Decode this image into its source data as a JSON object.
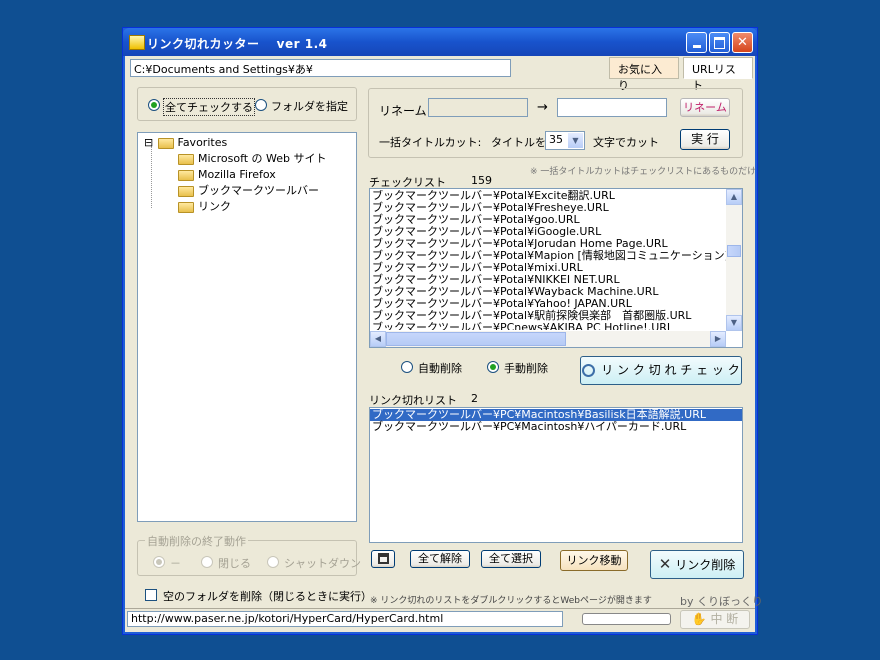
{
  "window": {
    "title": "リンク切れカッター　 ver 1.4"
  },
  "toolbar": {
    "path_value": "C:¥Documents and Settings¥あ¥",
    "tab_favorites": "お気に入り",
    "tab_url_list": "URLリスト"
  },
  "scope": {
    "all_check": "全てチェックする",
    "folder_select": "フォルダを指定",
    "selected": "all_check"
  },
  "tree": {
    "root_toggle": "⊟",
    "root": "Favorites",
    "children": [
      "Microsoft の Web サイト",
      "Mozilla Firefox",
      "ブックマークツールバー",
      "リンク"
    ]
  },
  "rename": {
    "label": "リネーム:",
    "arrow": "→",
    "from_value": "",
    "to_value": "",
    "button": "リネーム"
  },
  "title_cut": {
    "label": "一括タイトルカット:",
    "prefix": "タイトルを",
    "value": "35",
    "suffix": "文字でカット",
    "button": "実 行",
    "note": "※ 一括タイトルカットはチェックリストにあるものだけ"
  },
  "check_list": {
    "label": "チェックリスト",
    "count": "159",
    "items": [
      "ブックマークツールバー¥Potal¥Excite翻訳.URL",
      "ブックマークツールバー¥Potal¥Fresheye.URL",
      "ブックマークツールバー¥Potal¥goo.URL",
      "ブックマークツールバー¥Potal¥iGoogle.URL",
      "ブックマークツールバー¥Potal¥Jorudan Home Page.URL",
      "ブックマークツールバー¥Potal¥Mapion [情報地図コミュニケーション].URL",
      "ブックマークツールバー¥Potal¥mixi.URL",
      "ブックマークツールバー¥Potal¥NIKKEI NET.URL",
      "ブックマークツールバー¥Potal¥Wayback Machine.URL",
      "ブックマークツールバー¥Potal¥Yahoo! JAPAN.URL",
      "ブックマークツールバー¥Potal¥駅前探険倶楽部　首都圏版.URL",
      "ブックマークツールバー¥PCnews¥AKIBA PC Hotline!.URL"
    ]
  },
  "delete_mode": {
    "auto": "自動削除",
    "manual": "手動削除",
    "selected": "manual"
  },
  "check_button": "リ ン ク 切 れ チ ェ ッ ク",
  "broken_list": {
    "label": "リンク切れリスト",
    "count": "2",
    "items": [
      "ブックマークツールバー¥PC¥Macintosh¥Basilisk日本語解説.URL",
      "ブックマークツールバー¥PC¥Macintosh¥ハイパーカード.URL"
    ],
    "selected_index": 0
  },
  "auto_end": {
    "legend": "自動削除の終了動作",
    "options": [
      "－",
      "閉じる",
      "シャットダウン"
    ],
    "selected": 0
  },
  "empty_folder": {
    "label": "空のフォルダを削除（閉じるときに実行）",
    "checked": false
  },
  "buttons": {
    "unselect_all": "全て解除",
    "select_all": "全て選択",
    "move_link": "リンク移動",
    "delete_link": "リンク削除"
  },
  "footer": {
    "note": "※ リンク切れのリストをダブルクリックするとWebページが開きます",
    "credit": "by くりぼっくり",
    "url": "http://www.paser.ne.jp/kotori/HyperCard/HyperCard.html",
    "stop_button": "中 断"
  },
  "colors": {
    "desktop": "#0f4f92",
    "window_face": "#ece9d8",
    "selection": "#316ac5",
    "accent_button": "#e0f5f8"
  }
}
